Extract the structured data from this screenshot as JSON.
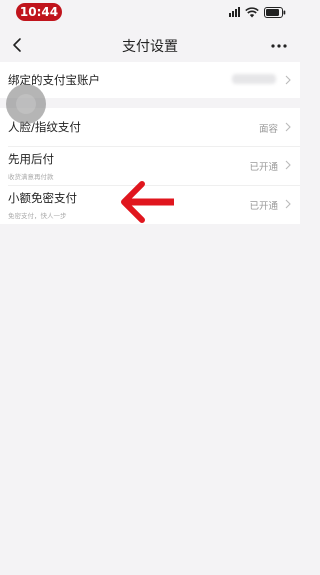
{
  "status_bar": {
    "time": "10:44"
  },
  "nav": {
    "title": "支付设置",
    "back_icon": "chevron-left-icon",
    "more_icon": "more-dots-icon"
  },
  "rows": {
    "account": {
      "title": "绑定的支付宝账户"
    },
    "face": {
      "title": "人脸/指纹支付",
      "value": "面容"
    },
    "pay_later": {
      "title": "先用后付",
      "subtitle": "收货满意再付款",
      "value": "已开通"
    },
    "small_free": {
      "title": "小额免密支付",
      "subtitle": "免密支付，快人一步",
      "value": "已开通"
    }
  },
  "colors": {
    "time_pill": "#c0141c",
    "arrow": "#e0161e",
    "background": "#f4f3f5"
  }
}
